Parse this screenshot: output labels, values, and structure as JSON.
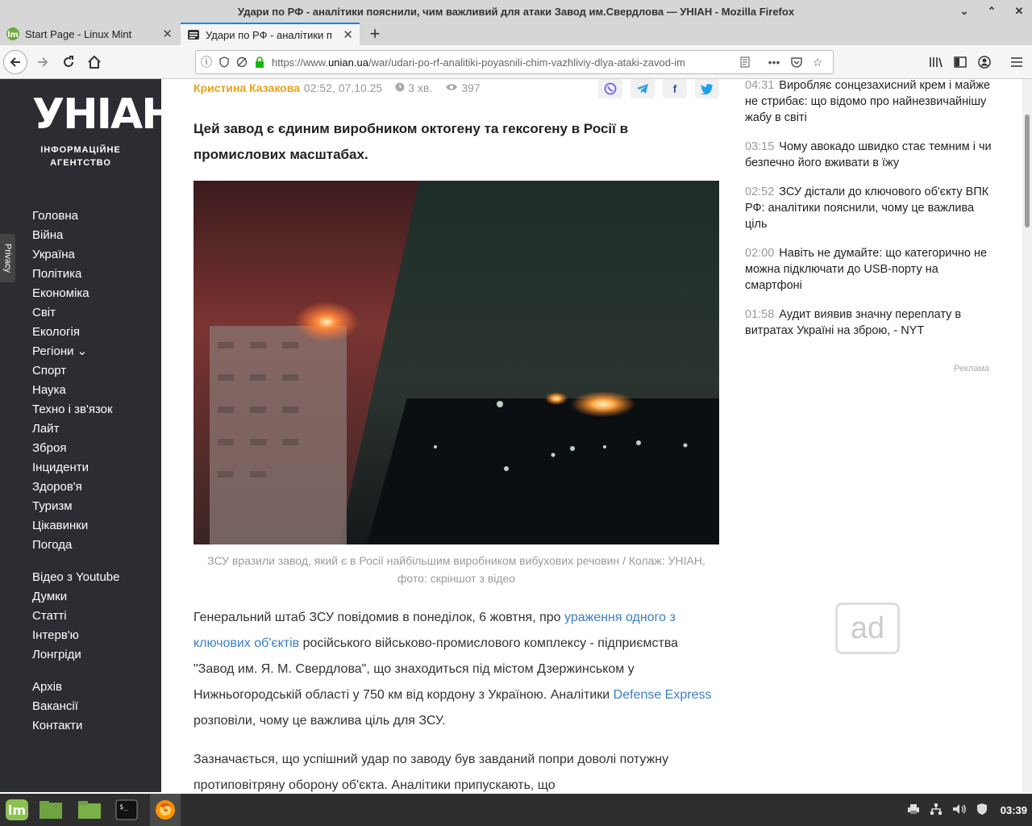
{
  "window": {
    "title": "Удари по РФ - аналітики пояснили, чим важливий для атаки Завод им.Свердлова — УНІАН - Mozilla Firefox",
    "controls": [
      "⌄",
      "⌃",
      "✕"
    ]
  },
  "tabs": [
    {
      "label": "Start Page - Linux Mint",
      "icon": "mint-icon"
    },
    {
      "label": "Удари по РФ - аналітики п",
      "icon": "page-icon"
    }
  ],
  "nav": {
    "url_prefix": "https://www.",
    "url_domain": "unian.ua",
    "url_path": "/war/udari-po-rf-analitiki-poyasnili-chim-vazhliviy-dlya-ataki-zavod-im"
  },
  "sidebar": {
    "logo": "УНІАН",
    "tagline_1": "ІНФОРМАЦІЙНЕ",
    "tagline_2": "АГЕНТСТВО",
    "privacy": "Privacy",
    "menu_main": [
      "Головна",
      "Війна",
      "Україна",
      "Політика",
      "Економіка",
      "Світ",
      "Екологія",
      "Регіони ⌄",
      "Спорт",
      "Наука",
      "Техно і зв'язок",
      "Лайт",
      "Зброя",
      "Інциденти",
      "Здоров'я",
      "Туризм",
      "Цікавинки",
      "Погода"
    ],
    "menu_secondary": [
      "Відео з Youtube",
      "Думки",
      "Статті",
      "Інтерв'ю",
      "Лонгріди"
    ],
    "menu_footer": [
      "Архів",
      "Вакансії",
      "Контакти"
    ]
  },
  "article": {
    "author": "Кристина Казакова",
    "datetime": "02:52, 07.10.25",
    "read_time": "3 хв.",
    "views": "397",
    "lead": "Цей завод є єдиним виробником октогену та гексогену в Росії в промислових масштабах.",
    "caption": "ЗСУ вразили завод, який є в Росії найбільшим виробником вибухових речовин / Колаж: УНІАН, фото: скріншот з відео",
    "p1_a": "Генеральний штаб ЗСУ повідомив в понеділок, 6 жовтня, про ",
    "p1_link": "ураження одного з ключових об'єктів",
    "p1_b": " російського військово-промислового комплексу - підприємства \"Завод им. Я. М. Свердлова\", що знаходиться під містом Дзержинськом у Нижньогородській області у 750 км від кордону з Україною. Аналітики ",
    "p1_link2": "Defense Express",
    "p1_c": " розповіли, чому це важлива ціль для ЗСУ.",
    "p2": "Зазначається, що успішний удар по заводу був завданий попри доволі потужну протиповітряну оборону об'єкта. Аналітики припускають, що"
  },
  "feed": [
    {
      "time": "04:31",
      "title": "Виробляє сонцезахисний крем і майже не стрибає: що відомо про найнезвичайнішу жабу в світі"
    },
    {
      "time": "03:15",
      "title": "Чому авокадо швидко стає темним і чи безпечно його вживати в їжу"
    },
    {
      "time": "02:52",
      "title": "ЗСУ дістали до ключового об'єкту ВПК РФ: аналітики пояснили, чому це важлива ціль"
    },
    {
      "time": "02:00",
      "title": "Навіть не думайте: що категорично не можна підключати до USB-порту на смартфоні"
    },
    {
      "time": "01:58",
      "title": "Аудит виявив значну переплату в витратах Україні на зброю, - NYT"
    }
  ],
  "ad": {
    "label": "Реклама",
    "placeholder": "ad"
  },
  "taskbar": {
    "clock": "03:39"
  }
}
